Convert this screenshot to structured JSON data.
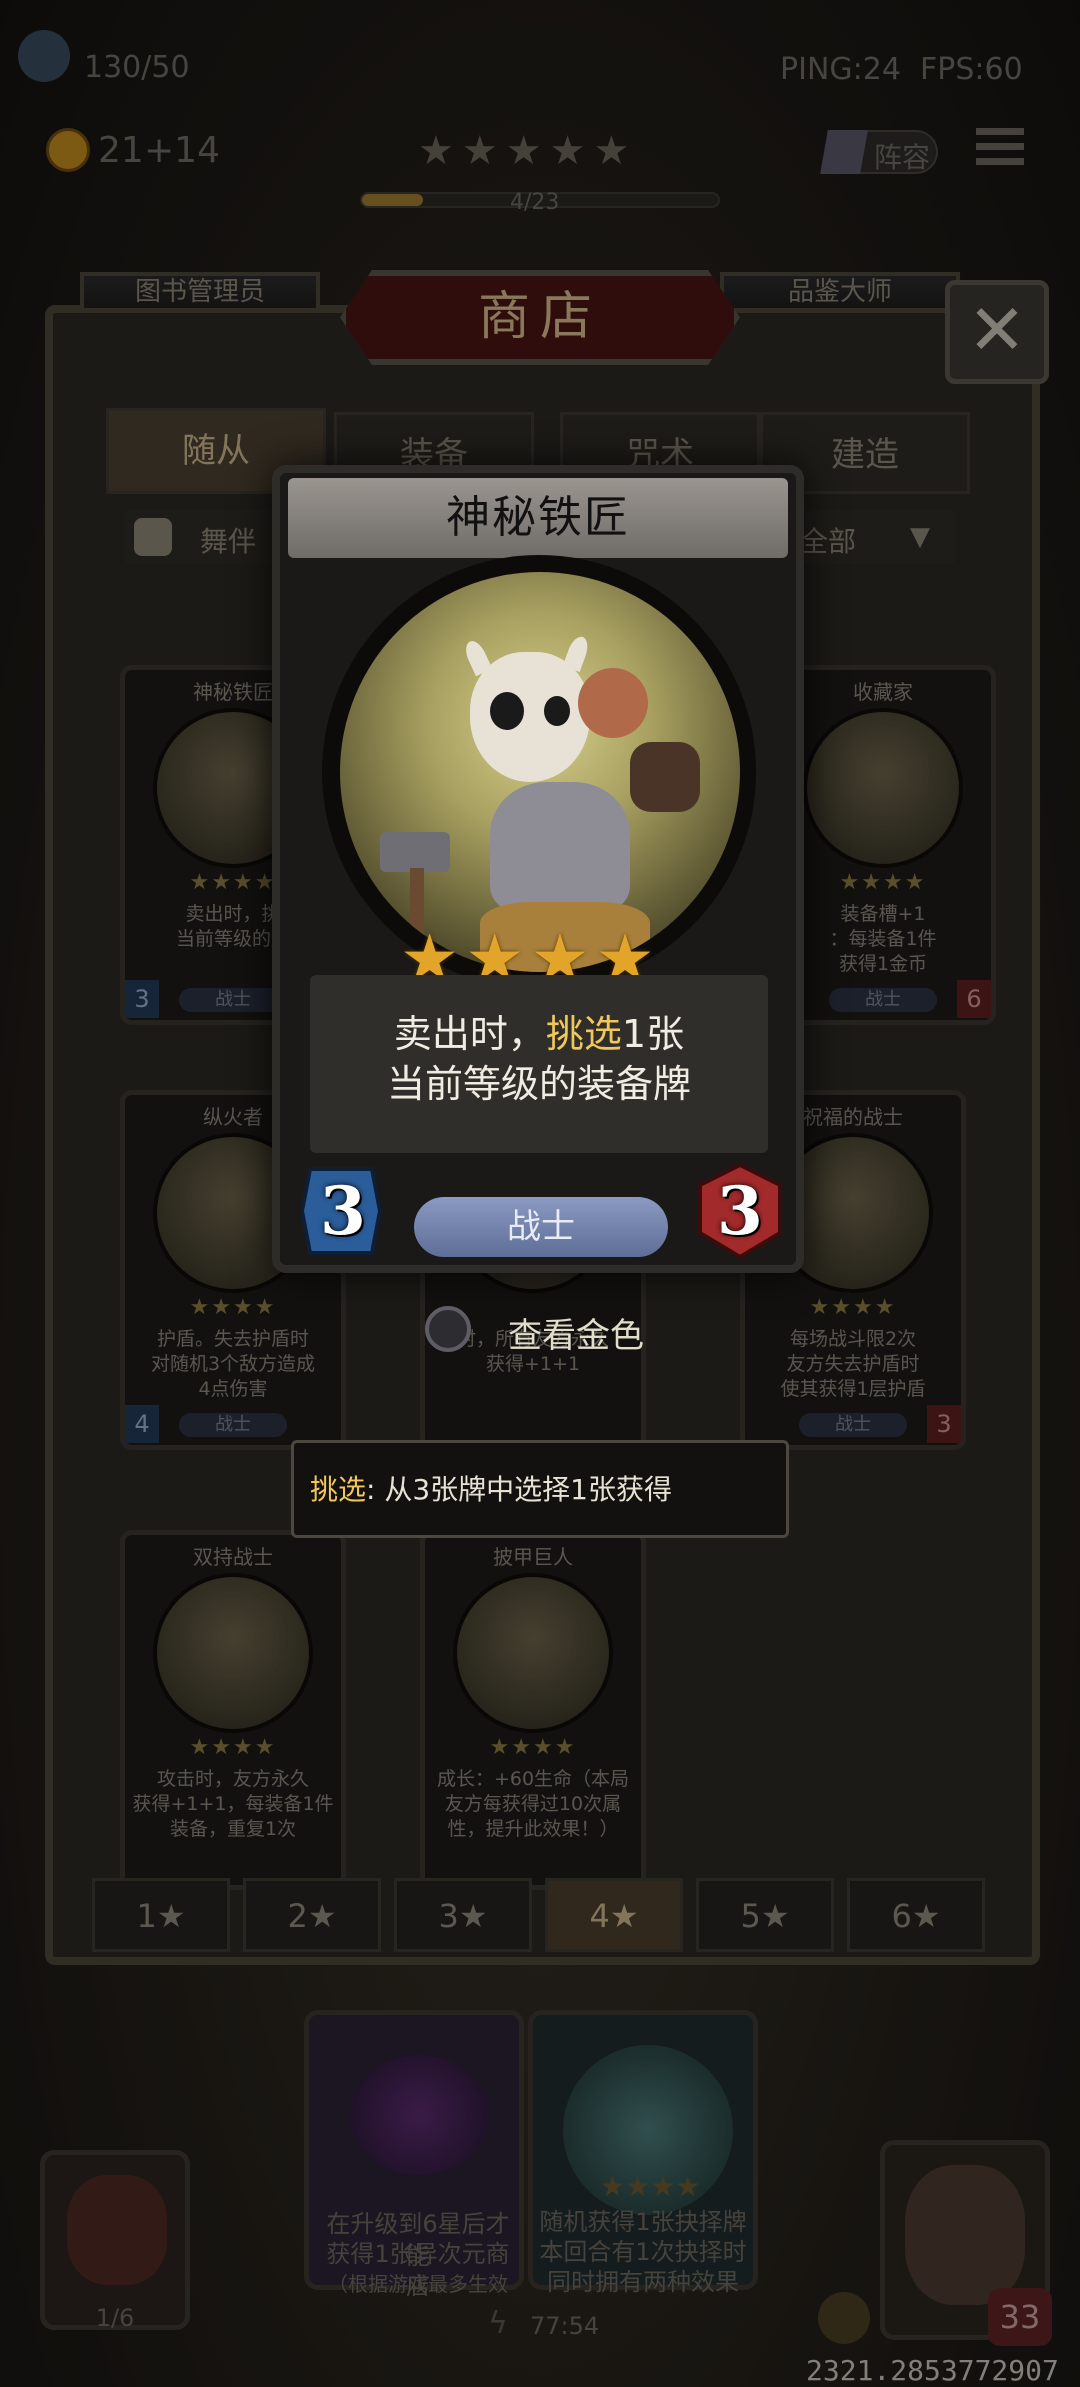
{
  "hud": {
    "players": "130/50",
    "gold": "21",
    "gold_income": "+14",
    "ping": "PING:24",
    "fps": "FPS:60",
    "stars": "★★★★★",
    "progress_label": "4/23",
    "progress": 0.17,
    "lineup_label": "阵容"
  },
  "shop": {
    "left_banner": "图书管理员",
    "right_banner": "品鉴大师",
    "title": "商店",
    "tabs": [
      "随从",
      "装备",
      "咒术",
      "建造"
    ],
    "filter_left": "舞伴",
    "filter_right": "全部",
    "star_filters": [
      "1★",
      "2★",
      "3★",
      "4★",
      "5★",
      "6★"
    ],
    "active_star_filter": 3
  },
  "mini_cards": [
    {
      "name": "神秘铁匠",
      "stars": "★★★★",
      "desc": [
        "卖出时，挑",
        "当前等级的装"
      ],
      "class": "战士",
      "cost": "3",
      "attack": ""
    },
    {
      "name": "收藏家",
      "stars": "★★★★",
      "desc": [
        "装备槽+1",
        "：每装备1件",
        "获得1金币"
      ],
      "class": "战士",
      "cost": "",
      "attack": "6"
    },
    {
      "name": "纵火者",
      "stars": "★★★★",
      "desc": [
        "护盾。失去护盾时",
        "对随机3个敌方造成",
        "4点伤害"
      ],
      "class": "战士",
      "cost": "4",
      "attack": ""
    },
    {
      "name": "",
      "stars": "",
      "desc": [
        "时，所有友方永久",
        "获得+1+1"
      ],
      "class": "",
      "cost": "",
      "attack": ""
    },
    {
      "name": "祝福的战士",
      "stars": "★★★★",
      "desc": [
        "每场战斗限2次",
        "友方失去护盾时",
        "使其获得1层护盾"
      ],
      "class": "战士",
      "cost": "",
      "attack": "3"
    },
    {
      "name": "双持战士",
      "stars": "★★★★",
      "desc": [
        "攻击时，友方永久",
        "获得+1+1，每装备1件",
        "装备，重复1次"
      ],
      "class": "",
      "cost": "",
      "attack": ""
    },
    {
      "name": "披甲巨人",
      "stars": "★★★★",
      "desc": [
        "成长：+60生命（本局",
        "友方每获得过10次属",
        "性，提升此效果！）"
      ],
      "class": "",
      "cost": "",
      "attack": ""
    }
  ],
  "card": {
    "name": "神秘铁匠",
    "stars": "★★★★",
    "desc_line1_a": "卖出时，",
    "desc_line1_hl": "挑选",
    "desc_line1_b": "1张",
    "desc_line2": "当前等级的装备牌",
    "class": "战士",
    "cost": "3",
    "attack": "3"
  },
  "gold_view": {
    "label": "查看金色"
  },
  "tooltip": {
    "keyword": "挑选",
    "text": ": 从3张牌中选择1张获得"
  },
  "bottom": {
    "left_card_text": [
      "在升级到6星后才能",
      "获得1张异次元商店",
      "（根据游戏最多生效"
    ],
    "right_card_text": [
      "随机获得1张抉择牌",
      "本回合有1次抉择时",
      "同时拥有两种效果"
    ],
    "hero_count": "1/6",
    "timer": "77:54",
    "health": "33",
    "coords": "2321.2853772907"
  },
  "colors": {
    "accent_gold": "#e2a52a",
    "highlight": "#f1c75a",
    "class_pill": "#7484ac",
    "cost_blue": "#2a5d9a",
    "attack_red": "#a32a2a"
  }
}
